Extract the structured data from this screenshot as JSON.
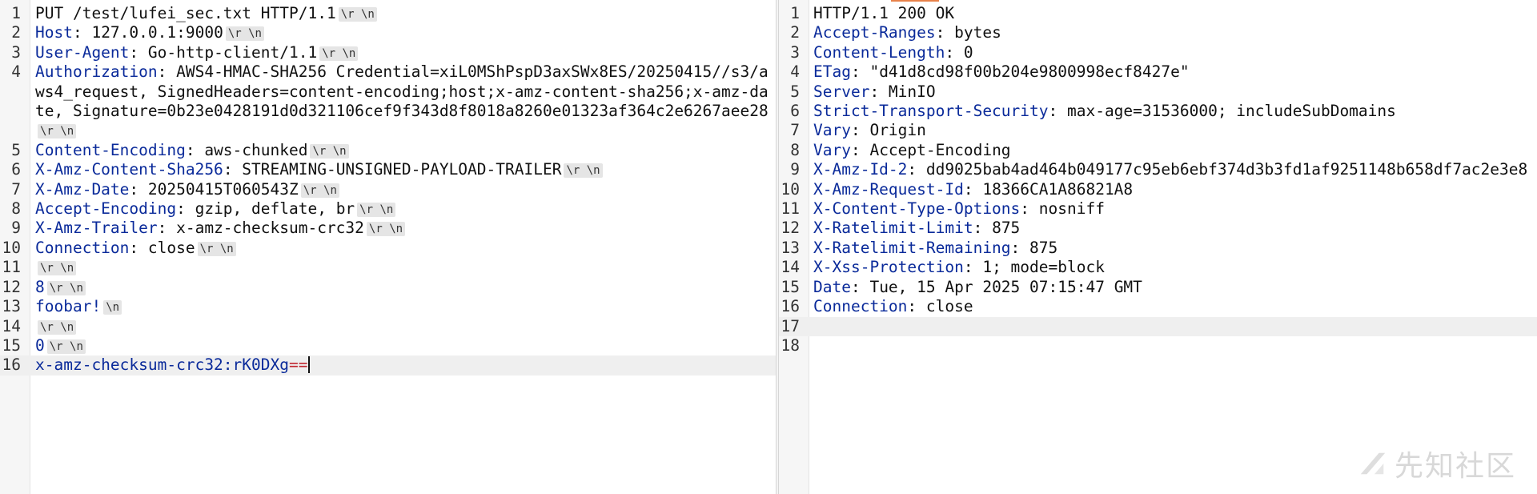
{
  "crlf_token": "\\r \\n",
  "lf_token": "\\n",
  "request": {
    "lines": [
      {
        "n": "1",
        "parts": [
          {
            "t": "PUT /test/lufei_sec.txt HTTP/1.1",
            "c": ""
          },
          {
            "tok": "crlf"
          }
        ]
      },
      {
        "n": "2",
        "parts": [
          {
            "t": "Host",
            "c": "hname"
          },
          {
            "t": ": 127.0.0.1:9000",
            "c": ""
          },
          {
            "tok": "crlf"
          }
        ]
      },
      {
        "n": "3",
        "parts": [
          {
            "t": "User-Agent",
            "c": "hname"
          },
          {
            "t": ": Go-http-client/1.1",
            "c": ""
          },
          {
            "tok": "crlf"
          }
        ]
      },
      {
        "n": "4",
        "parts": [
          {
            "t": "Authorization",
            "c": "hname"
          },
          {
            "t": ": AWS4-HMAC-SHA256 Credential=xiL0MShPspD3axSWx8ES/20250415//s3/aws4_request, SignedHeaders=content-encoding;host;x-amz-content-sha256;x-amz-date, Signature=0b23e0428191d0d321106cef9f343d8f8018a8260e01323af364c2e6267aee28",
            "c": ""
          },
          {
            "tok": "crlf"
          }
        ]
      },
      {
        "n": "5",
        "parts": [
          {
            "t": "Content-Encoding",
            "c": "hname"
          },
          {
            "t": ": aws-chunked",
            "c": ""
          },
          {
            "tok": "crlf"
          }
        ]
      },
      {
        "n": "6",
        "parts": [
          {
            "t": "X-Amz-Content-Sha256",
            "c": "hname"
          },
          {
            "t": ": STREAMING-UNSIGNED-PAYLOAD-TRAILER",
            "c": ""
          },
          {
            "tok": "crlf"
          }
        ]
      },
      {
        "n": "7",
        "parts": [
          {
            "t": "X-Amz-Date",
            "c": "hname"
          },
          {
            "t": ": 20250415T060543Z",
            "c": ""
          },
          {
            "tok": "crlf"
          }
        ]
      },
      {
        "n": "8",
        "parts": [
          {
            "t": "Accept-Encoding",
            "c": "hname"
          },
          {
            "t": ": gzip, deflate, br",
            "c": ""
          },
          {
            "tok": "crlf"
          }
        ]
      },
      {
        "n": "9",
        "parts": [
          {
            "t": "X-Amz-Trailer",
            "c": "hname"
          },
          {
            "t": ": x-amz-checksum-crc32",
            "c": ""
          },
          {
            "tok": "crlf"
          }
        ]
      },
      {
        "n": "10",
        "parts": [
          {
            "t": "Connection",
            "c": "hname"
          },
          {
            "t": ": close",
            "c": ""
          },
          {
            "tok": "crlf"
          }
        ]
      },
      {
        "n": "11",
        "parts": [
          {
            "tok": "crlf"
          }
        ]
      },
      {
        "n": "12",
        "parts": [
          {
            "t": "8",
            "c": "kw"
          },
          {
            "tok": "crlf"
          }
        ]
      },
      {
        "n": "13",
        "parts": [
          {
            "t": "foobar!",
            "c": "kw"
          },
          {
            "tok": "lf"
          }
        ]
      },
      {
        "n": "14",
        "parts": [
          {
            "tok": "crlf"
          }
        ]
      },
      {
        "n": "15",
        "parts": [
          {
            "t": "0",
            "c": "kw"
          },
          {
            "tok": "crlf"
          }
        ]
      },
      {
        "n": "16",
        "highlight": true,
        "parts": [
          {
            "t": "x-amz-checksum-crc32:rK0DXg",
            "c": "kw"
          },
          {
            "t": "==",
            "c": "red"
          },
          {
            "caret": true
          }
        ]
      }
    ]
  },
  "response": {
    "lines": [
      {
        "n": "1",
        "parts": [
          {
            "t": "HTTP/1.1 200 OK",
            "c": ""
          }
        ]
      },
      {
        "n": "2",
        "parts": [
          {
            "t": "Accept-Ranges",
            "c": "hname"
          },
          {
            "t": ": bytes",
            "c": ""
          }
        ]
      },
      {
        "n": "3",
        "parts": [
          {
            "t": "Content-Length",
            "c": "hname"
          },
          {
            "t": ": 0",
            "c": ""
          }
        ]
      },
      {
        "n": "4",
        "parts": [
          {
            "t": "ETag",
            "c": "hname"
          },
          {
            "t": ": \"d41d8cd98f00b204e9800998ecf8427e\"",
            "c": ""
          }
        ]
      },
      {
        "n": "5",
        "parts": [
          {
            "t": "Server",
            "c": "hname"
          },
          {
            "t": ": MinIO",
            "c": ""
          }
        ]
      },
      {
        "n": "6",
        "parts": [
          {
            "t": "Strict-Transport-Security",
            "c": "hname"
          },
          {
            "t": ": max-age=31536000; includeSubDomains",
            "c": ""
          }
        ]
      },
      {
        "n": "7",
        "parts": [
          {
            "t": "Vary",
            "c": "hname"
          },
          {
            "t": ": Origin",
            "c": ""
          }
        ]
      },
      {
        "n": "8",
        "parts": [
          {
            "t": "Vary",
            "c": "hname"
          },
          {
            "t": ": Accept-Encoding",
            "c": ""
          }
        ]
      },
      {
        "n": "9",
        "parts": [
          {
            "t": "X-Amz-Id-2",
            "c": "hname"
          },
          {
            "t": ": dd9025bab4ad464b049177c95eb6ebf374d3b3fd1af9251148b658df7ac2e3e8",
            "c": ""
          }
        ]
      },
      {
        "n": "10",
        "parts": [
          {
            "t": "X-Amz-Request-Id",
            "c": "hname"
          },
          {
            "t": ": 18366CA1A86821A8",
            "c": ""
          }
        ]
      },
      {
        "n": "11",
        "parts": [
          {
            "t": "X-Content-Type-Options",
            "c": "hname"
          },
          {
            "t": ": nosniff",
            "c": ""
          }
        ]
      },
      {
        "n": "12",
        "parts": [
          {
            "t": "X-Ratelimit-Limit",
            "c": "hname"
          },
          {
            "t": ": 875",
            "c": ""
          }
        ]
      },
      {
        "n": "13",
        "parts": [
          {
            "t": "X-Ratelimit-Remaining",
            "c": "hname"
          },
          {
            "t": ": 875",
            "c": ""
          }
        ]
      },
      {
        "n": "14",
        "parts": [
          {
            "t": "X-Xss-Protection",
            "c": "hname"
          },
          {
            "t": ": 1; mode=block",
            "c": ""
          }
        ]
      },
      {
        "n": "15",
        "parts": [
          {
            "t": "Date",
            "c": "hname"
          },
          {
            "t": ": Tue, 15 Apr 2025 07:15:47 GMT",
            "c": ""
          }
        ]
      },
      {
        "n": "16",
        "parts": [
          {
            "t": "Connection",
            "c": "hname"
          },
          {
            "t": ": close",
            "c": ""
          }
        ]
      },
      {
        "n": "17",
        "highlight": true,
        "parts": []
      },
      {
        "n": "18",
        "parts": []
      }
    ]
  },
  "watermark": {
    "text": "先知社区",
    "icon": "xianzhi-logo-icon"
  },
  "colors": {
    "header_name": "#0a2a9a",
    "accent": "#e8824a",
    "highlight_line": "#efefef",
    "token_bg": "#e5e5e5"
  }
}
